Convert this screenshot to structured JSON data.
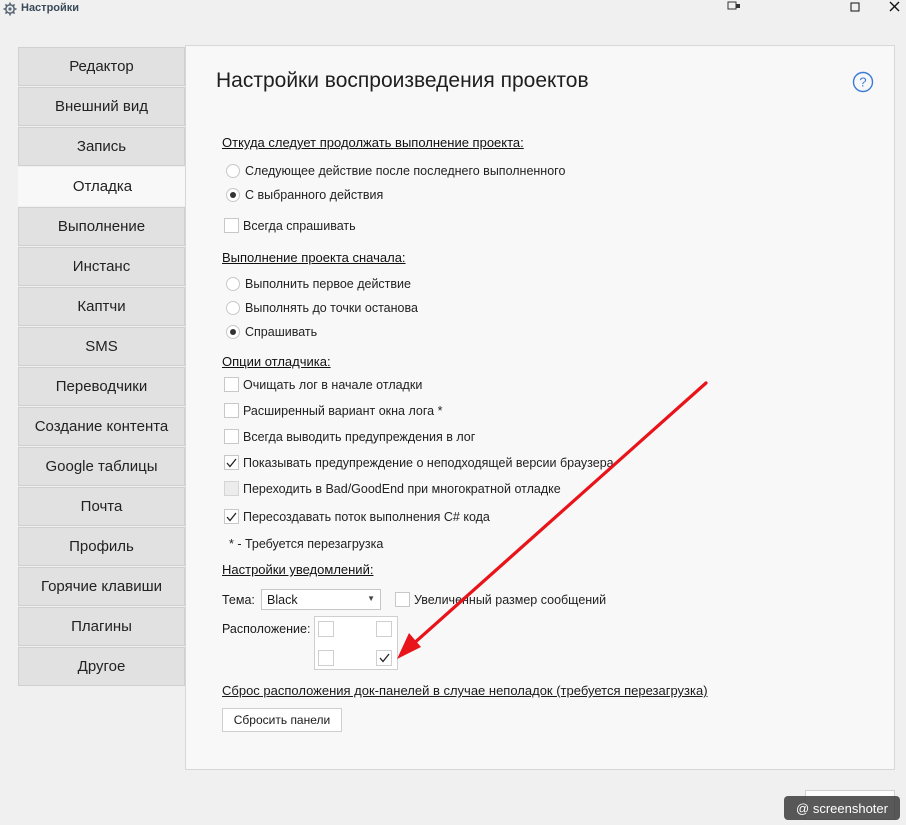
{
  "window": {
    "title": "Настройки",
    "controls": {
      "restore": "▭",
      "maximize": "☐",
      "close": "✕"
    }
  },
  "sidebar": {
    "items": [
      {
        "label": "Редактор"
      },
      {
        "label": "Внешний вид"
      },
      {
        "label": "Запись"
      },
      {
        "label": "Отладка",
        "active": true
      },
      {
        "label": "Выполнение"
      },
      {
        "label": "Инстанс"
      },
      {
        "label": "Каптчи"
      },
      {
        "label": "SMS"
      },
      {
        "label": "Переводчики"
      },
      {
        "label": "Создание контента"
      },
      {
        "label": "Google таблицы"
      },
      {
        "label": "Почта"
      },
      {
        "label": "Профиль"
      },
      {
        "label": "Горячие клавиши"
      },
      {
        "label": "Плагины"
      },
      {
        "label": "Другое"
      }
    ]
  },
  "main": {
    "title": "Настройки воспроизведения проектов",
    "continue_section": {
      "label": "Откуда следует продолжать выполнение проекта:",
      "options": [
        {
          "label": "Следующее действие после последнего выполненного",
          "checked": false
        },
        {
          "label": "С выбранного действия",
          "checked": true
        }
      ],
      "always_ask": {
        "label": "Всегда спрашивать",
        "checked": false
      }
    },
    "restart_section": {
      "label": "Выполнение проекта сначала:",
      "options": [
        {
          "label": "Выполнить первое действие",
          "checked": false
        },
        {
          "label": "Выполнять до точки останова",
          "checked": false
        },
        {
          "label": "Спрашивать",
          "checked": true
        }
      ]
    },
    "debugger_section": {
      "label": "Опции отладчика:",
      "options": [
        {
          "label": "Очищать лог в начале отладки",
          "checked": false
        },
        {
          "label": "Расширенный вариант окна лога *",
          "checked": false
        },
        {
          "label": "Всегда выводить предупреждения в лог",
          "checked": false
        },
        {
          "label": "Показывать предупреждение о неподходящей версии браузера",
          "checked": true
        },
        {
          "label": "Переходить в Bad/GoodEnd при многократной отладке",
          "checked": false,
          "disabled": true
        },
        {
          "label": "Пересоздавать поток выполнения C# кода",
          "checked": true
        }
      ],
      "note": "* - Требуется перезагрузка"
    },
    "notifications_section": {
      "label": "Настройки уведомлений:",
      "theme_label": "Тема:",
      "theme_value": "Black",
      "large_messages": {
        "label": "Увеличенный размер сообщений",
        "checked": false
      },
      "position_label": "Расположение:",
      "position_selected": "bottom-right"
    },
    "reset_section": {
      "label": "Сброс расположения док-панелей в случае неполадок (требуется перезагрузка)",
      "button": "Сбросить панели"
    }
  },
  "watermark": "@ screenshoter",
  "colors": {
    "accent": "#3b7bd8",
    "annotation_arrow": "#e8141a"
  }
}
